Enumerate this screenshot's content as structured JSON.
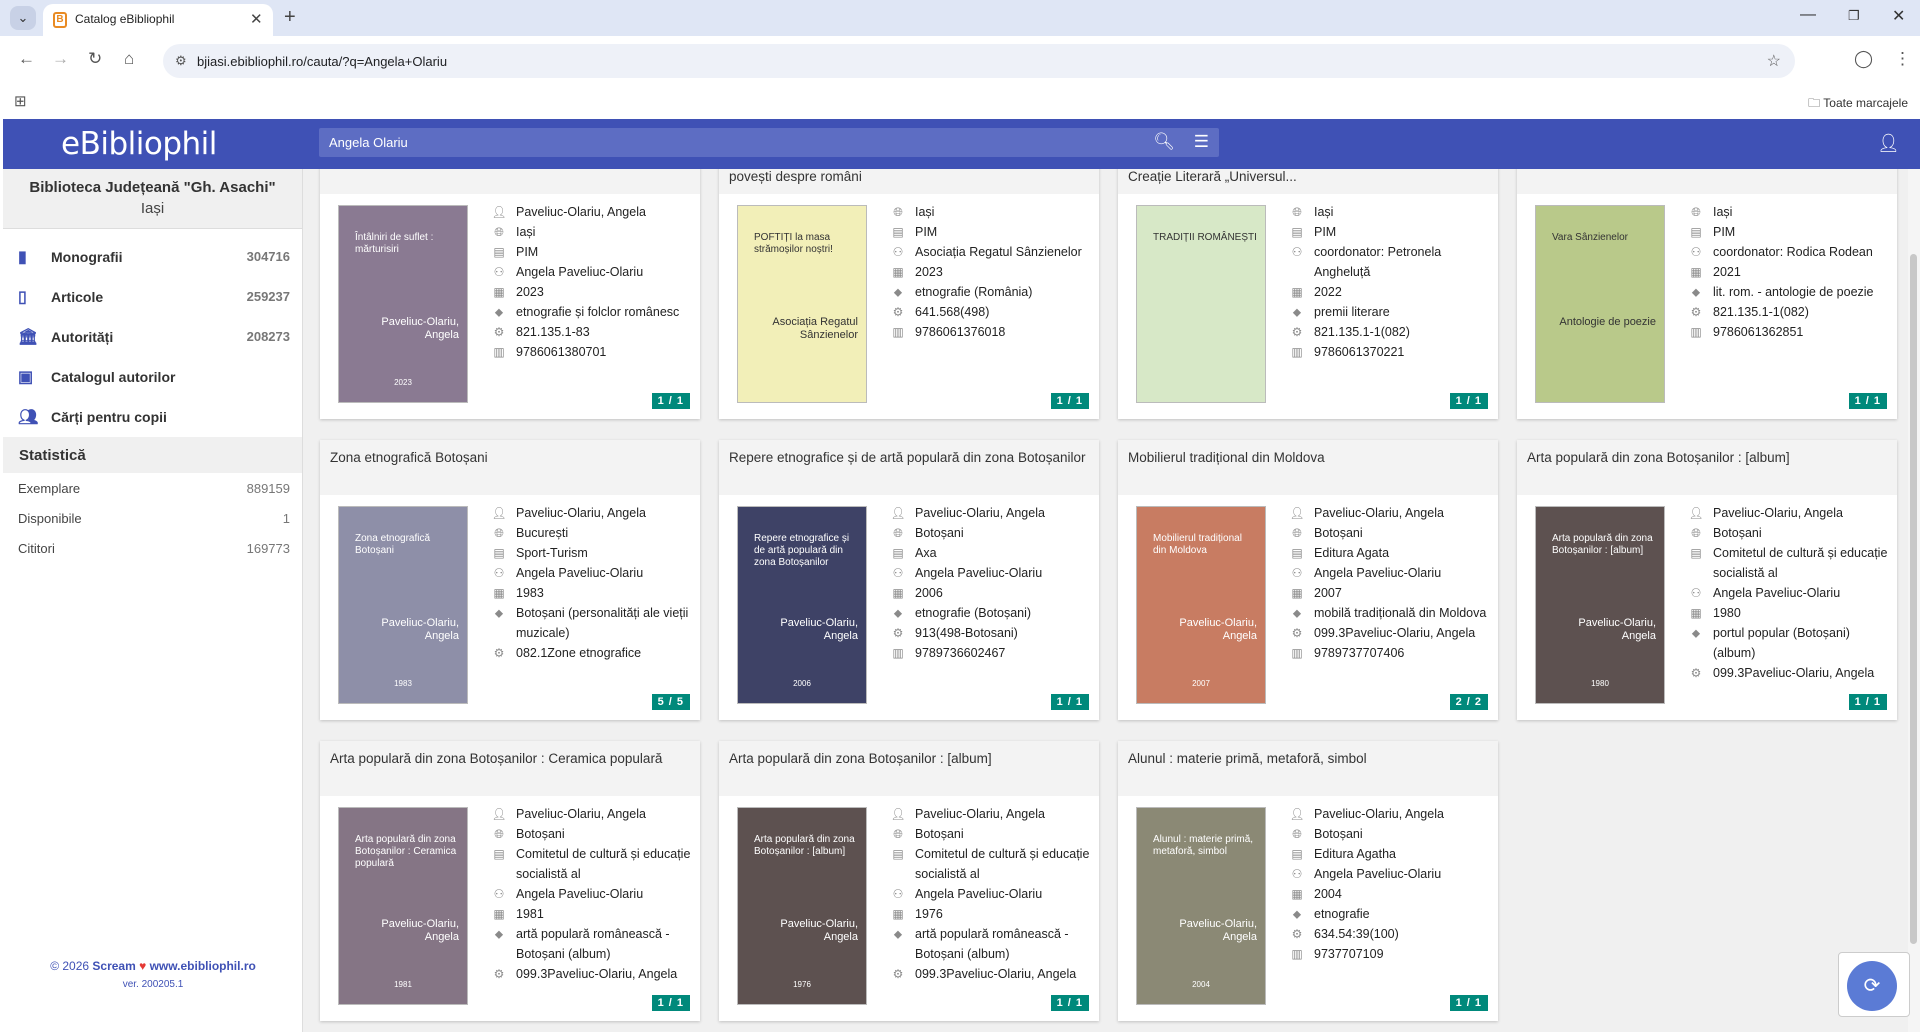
{
  "browser": {
    "tab_title": "Catalog eBibliophil",
    "tab_favicon": "B",
    "tab_selector_icon": "⌄",
    "url": "bjiasi.ebibliophil.ro/cauta/?q=Angela+Olariu",
    "bookmarks_all": "Toate marcajele"
  },
  "app": {
    "logo": "eBibliophil",
    "search_value": "Angela Olariu",
    "accent": "#3f51b5",
    "badge_color": "#00897b"
  },
  "sidebar": {
    "library_name": "Biblioteca Județeană \"Gh. Asachi\"",
    "library_city": "Iași",
    "items": [
      {
        "label": "Monografii",
        "count": "304716",
        "icon": "book-icon"
      },
      {
        "label": "Articole",
        "count": "259237",
        "icon": "open-book-icon"
      },
      {
        "label": "Autorități",
        "count": "208273",
        "icon": "institution-icon"
      },
      {
        "label": "Catalogul autorilor",
        "count": "",
        "icon": "person-card-icon"
      },
      {
        "label": "Cărți pentru copii",
        "count": "",
        "icon": "people-icon"
      }
    ],
    "stats_title": "Statistică",
    "stats": [
      {
        "label": "Exemplare",
        "value": "889159"
      },
      {
        "label": "Disponibile",
        "value": "1"
      },
      {
        "label": "Cititori",
        "value": "169773"
      }
    ],
    "footer_year": "© 2026",
    "footer_brand": "Scream",
    "footer_site": "www.ebibliophil.ro",
    "footer_version": "ver. 200205.1"
  },
  "cards": [
    {
      "title": "Întâlniri de suflet : mărturisiri",
      "cover_title": "Întâlniri de suflet : mărturisiri",
      "cover_author": "Paveliuc-Olariu, Angela",
      "cover_year": "2023",
      "cover_color": "#8a7a92",
      "fields": [
        {
          "icon": "person-icon",
          "text": "Paveliuc-Olariu, Angela"
        },
        {
          "icon": "globe-icon",
          "text": "Iași"
        },
        {
          "icon": "publisher-icon",
          "text": "PIM"
        },
        {
          "icon": "person-add-icon",
          "text": "Angela Paveliuc-Olariu"
        },
        {
          "icon": "calendar-icon",
          "text": "2023"
        },
        {
          "icon": "tag-icon",
          "text": "etnografie și folclor românesc"
        },
        {
          "icon": "gear-icon",
          "text": "821.135.1-83"
        },
        {
          "icon": "isbn-icon",
          "text": "9786061380701"
        }
      ],
      "badge": "1 / 1"
    },
    {
      "title": "POFTIȚI la masa strămoșilor noștri! : Bucate românești și povești despre români",
      "cover_title": "POFTIȚI la masa strămoșilor noștri!",
      "cover_author": "Asociația Regatul Sânzienelor",
      "cover_year": "",
      "cover_color": "#f2efb8",
      "fields": [
        {
          "icon": "globe-icon",
          "text": "Iași"
        },
        {
          "icon": "publisher-icon",
          "text": "PIM"
        },
        {
          "icon": "person-add-icon",
          "text": "Asociația Regatul Sânzienelor"
        },
        {
          "icon": "calendar-icon",
          "text": "2023"
        },
        {
          "icon": "tag-icon",
          "text": "etnografie (România)"
        },
        {
          "icon": "gear-icon",
          "text": "641.568(498)"
        },
        {
          "icon": "isbn-icon",
          "text": "9786061376018"
        }
      ],
      "badge": "1 / 1"
    },
    {
      "title": "Tradiții românești : antologia Concursului Internațional de Creație Literară „Universul...",
      "cover_title": "TRADIȚII ROMÂNEȘTI",
      "cover_author": "",
      "cover_year": "",
      "cover_color": "#d7e8c7",
      "fields": [
        {
          "icon": "globe-icon",
          "text": "Iași"
        },
        {
          "icon": "publisher-icon",
          "text": "PIM"
        },
        {
          "icon": "person-add-icon",
          "text": "coordonator: Petronela Angheluță"
        },
        {
          "icon": "calendar-icon",
          "text": "2022"
        },
        {
          "icon": "tag-icon",
          "text": "premii literare"
        },
        {
          "icon": "gear-icon",
          "text": "821.135.1-1(082)"
        },
        {
          "icon": "isbn-icon",
          "text": "9786061370221"
        }
      ],
      "badge": "1 / 1"
    },
    {
      "title": "VARA Sânzienelor : antologie de poezie",
      "cover_title": "Vara Sânzienelor",
      "cover_author": "Antologie de poezie",
      "cover_year": "",
      "cover_color": "#b9c98a",
      "fields": [
        {
          "icon": "globe-icon",
          "text": "Iași"
        },
        {
          "icon": "publisher-icon",
          "text": "PIM"
        },
        {
          "icon": "person-add-icon",
          "text": "coordonator: Rodica Rodean"
        },
        {
          "icon": "calendar-icon",
          "text": "2021"
        },
        {
          "icon": "tag-icon",
          "text": "lit. rom. - antologie de poezie"
        },
        {
          "icon": "gear-icon",
          "text": "821.135.1-1(082)"
        },
        {
          "icon": "isbn-icon",
          "text": "9786061362851"
        }
      ],
      "badge": "1 / 1"
    },
    {
      "title": "Zona etnografică Botoșani",
      "cover_title": "Zona etnografică Botoșani",
      "cover_author": "Paveliuc-Olariu, Angela",
      "cover_year": "1983",
      "cover_color": "#8e8fa8",
      "fields": [
        {
          "icon": "person-icon",
          "text": "Paveliuc-Olariu, Angela"
        },
        {
          "icon": "globe-icon",
          "text": "București"
        },
        {
          "icon": "publisher-icon",
          "text": "Sport-Turism"
        },
        {
          "icon": "person-add-icon",
          "text": "Angela Paveliuc-Olariu"
        },
        {
          "icon": "calendar-icon",
          "text": "1983"
        },
        {
          "icon": "tag-icon",
          "text": "Botoșani (personalități ale vieții muzicale)"
        },
        {
          "icon": "gear-icon",
          "text": "082.1Zone etnografice"
        }
      ],
      "badge": "5 / 5"
    },
    {
      "title": "Repere etnografice și de artă populară din zona Botoșanilor",
      "cover_title": "Repere etnografice și de artă populară din zona Botoșanilor",
      "cover_author": "Paveliuc-Olariu, Angela",
      "cover_year": "2006",
      "cover_color": "#3e4266",
      "fields": [
        {
          "icon": "person-icon",
          "text": "Paveliuc-Olariu, Angela"
        },
        {
          "icon": "globe-icon",
          "text": "Botoșani"
        },
        {
          "icon": "publisher-icon",
          "text": "Axa"
        },
        {
          "icon": "person-add-icon",
          "text": "Angela Paveliuc-Olariu"
        },
        {
          "icon": "calendar-icon",
          "text": "2006"
        },
        {
          "icon": "tag-icon",
          "text": "etnografie (Botoșani)"
        },
        {
          "icon": "gear-icon",
          "text": "913(498-Botosani)"
        },
        {
          "icon": "isbn-icon",
          "text": "9789736602467"
        }
      ],
      "badge": "1 / 1"
    },
    {
      "title": "Mobilierul tradițional din Moldova",
      "cover_title": "Mobilierul tradițional din Moldova",
      "cover_author": "Paveliuc-Olariu, Angela",
      "cover_year": "2007",
      "cover_color": "#c87c62",
      "fields": [
        {
          "icon": "person-icon",
          "text": "Paveliuc-Olariu, Angela"
        },
        {
          "icon": "globe-icon",
          "text": "Botoșani"
        },
        {
          "icon": "publisher-icon",
          "text": "Editura Agata"
        },
        {
          "icon": "person-add-icon",
          "text": "Angela Paveliuc-Olariu"
        },
        {
          "icon": "calendar-icon",
          "text": "2007"
        },
        {
          "icon": "tag-icon",
          "text": "mobilă tradițională din Moldova"
        },
        {
          "icon": "gear-icon",
          "text": "099.3Paveliuc-Olariu, Angela"
        },
        {
          "icon": "isbn-icon",
          "text": "9789737707406"
        }
      ],
      "badge": "2 / 2"
    },
    {
      "title": "Arta populară din zona Botoșanilor : [album]",
      "cover_title": "Arta populară din zona Botoșanilor : [album]",
      "cover_author": "Paveliuc-Olariu, Angela",
      "cover_year": "1980",
      "cover_color": "#5d5150",
      "fields": [
        {
          "icon": "person-icon",
          "text": "Paveliuc-Olariu, Angela"
        },
        {
          "icon": "globe-icon",
          "text": "Botoșani"
        },
        {
          "icon": "publisher-icon",
          "text": "Comitetul de cultură și educație socialistă al"
        },
        {
          "icon": "person-add-icon",
          "text": "Angela Paveliuc-Olariu"
        },
        {
          "icon": "calendar-icon",
          "text": "1980"
        },
        {
          "icon": "tag-icon",
          "text": "portul popular (Botoșani) (album)"
        },
        {
          "icon": "gear-icon",
          "text": "099.3Paveliuc-Olariu, Angela"
        }
      ],
      "badge": "1 / 1"
    },
    {
      "title": "Arta populară din zona Botoșanilor : Ceramica populară",
      "cover_title": "Arta populară din zona Botoșanilor : Ceramica populară",
      "cover_author": "Paveliuc-Olariu, Angela",
      "cover_year": "1981",
      "cover_color": "#857585",
      "fields": [
        {
          "icon": "person-icon",
          "text": "Paveliuc-Olariu, Angela"
        },
        {
          "icon": "globe-icon",
          "text": "Botoșani"
        },
        {
          "icon": "publisher-icon",
          "text": "Comitetul de cultură și educație socialistă al"
        },
        {
          "icon": "person-add-icon",
          "text": "Angela Paveliuc-Olariu"
        },
        {
          "icon": "calendar-icon",
          "text": "1981"
        },
        {
          "icon": "tag-icon",
          "text": "artă populară românească - Botoșani (album)"
        },
        {
          "icon": "gear-icon",
          "text": "099.3Paveliuc-Olariu, Angela"
        }
      ],
      "badge": "1 / 1"
    },
    {
      "title": "Arta populară din zona Botoșanilor : [album]",
      "cover_title": "Arta populară din zona Botoșanilor : [album]",
      "cover_author": "Paveliuc-Olariu, Angela",
      "cover_year": "1976",
      "cover_color": "#5d5150",
      "fields": [
        {
          "icon": "person-icon",
          "text": "Paveliuc-Olariu, Angela"
        },
        {
          "icon": "globe-icon",
          "text": "Botoșani"
        },
        {
          "icon": "publisher-icon",
          "text": "Comitetul de cultură și educație socialistă al"
        },
        {
          "icon": "person-add-icon",
          "text": "Angela Paveliuc-Olariu"
        },
        {
          "icon": "calendar-icon",
          "text": "1976"
        },
        {
          "icon": "tag-icon",
          "text": "artă populară românească - Botoșani (album)"
        },
        {
          "icon": "gear-icon",
          "text": "099.3Paveliuc-Olariu, Angela"
        }
      ],
      "badge": "1 / 1"
    },
    {
      "title": "Alunul : materie primă, metaforă, simbol",
      "cover_title": "Alunul : materie primă, metaforă, simbol",
      "cover_author": "Paveliuc-Olariu, Angela",
      "cover_year": "2004",
      "cover_color": "#8b8975",
      "fields": [
        {
          "icon": "person-icon",
          "text": "Paveliuc-Olariu, Angela"
        },
        {
          "icon": "globe-icon",
          "text": "Botoșani"
        },
        {
          "icon": "publisher-icon",
          "text": "Editura Agatha"
        },
        {
          "icon": "person-add-icon",
          "text": "Angela Paveliuc-Olariu"
        },
        {
          "icon": "calendar-icon",
          "text": "2004"
        },
        {
          "icon": "tag-icon",
          "text": "etnografie"
        },
        {
          "icon": "gear-icon",
          "text": "634.54:39(100)"
        },
        {
          "icon": "isbn-icon",
          "text": "9737707109"
        }
      ],
      "badge": "1 / 1"
    }
  ]
}
